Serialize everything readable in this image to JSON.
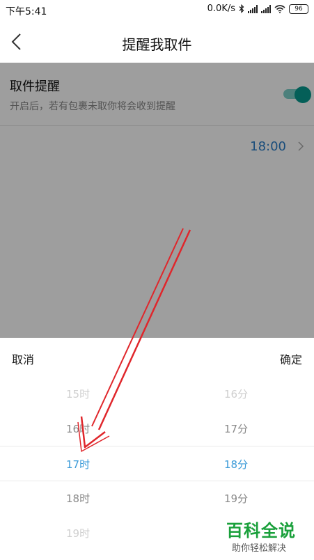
{
  "status_bar": {
    "time": "下午5:41",
    "network_speed": "0.0K/s",
    "battery": "96",
    "icons": [
      "bluetooth-icon",
      "signal-icon",
      "signal-icon",
      "wifi-icon",
      "battery-icon"
    ]
  },
  "header": {
    "title": "提醒我取件",
    "back_icon": "chevron-left-icon"
  },
  "reminder": {
    "title": "取件提醒",
    "description": "开启后，若有包裹未取你将会收到提醒",
    "toggle_on": true,
    "toggle_color": "#079a8f",
    "time_value": "18:00"
  },
  "picker": {
    "cancel_label": "取消",
    "confirm_label": "确定",
    "hours": [
      "15时",
      "16时",
      "17时",
      "18时",
      "19时"
    ],
    "minutes": [
      "16分",
      "17分",
      "18分",
      "19分"
    ],
    "selected_hour": "17时",
    "selected_minute": "18分",
    "selected_color": "#3a9ad8"
  },
  "watermark": {
    "title": "百科全说",
    "subtitle": "助你轻松解决"
  }
}
